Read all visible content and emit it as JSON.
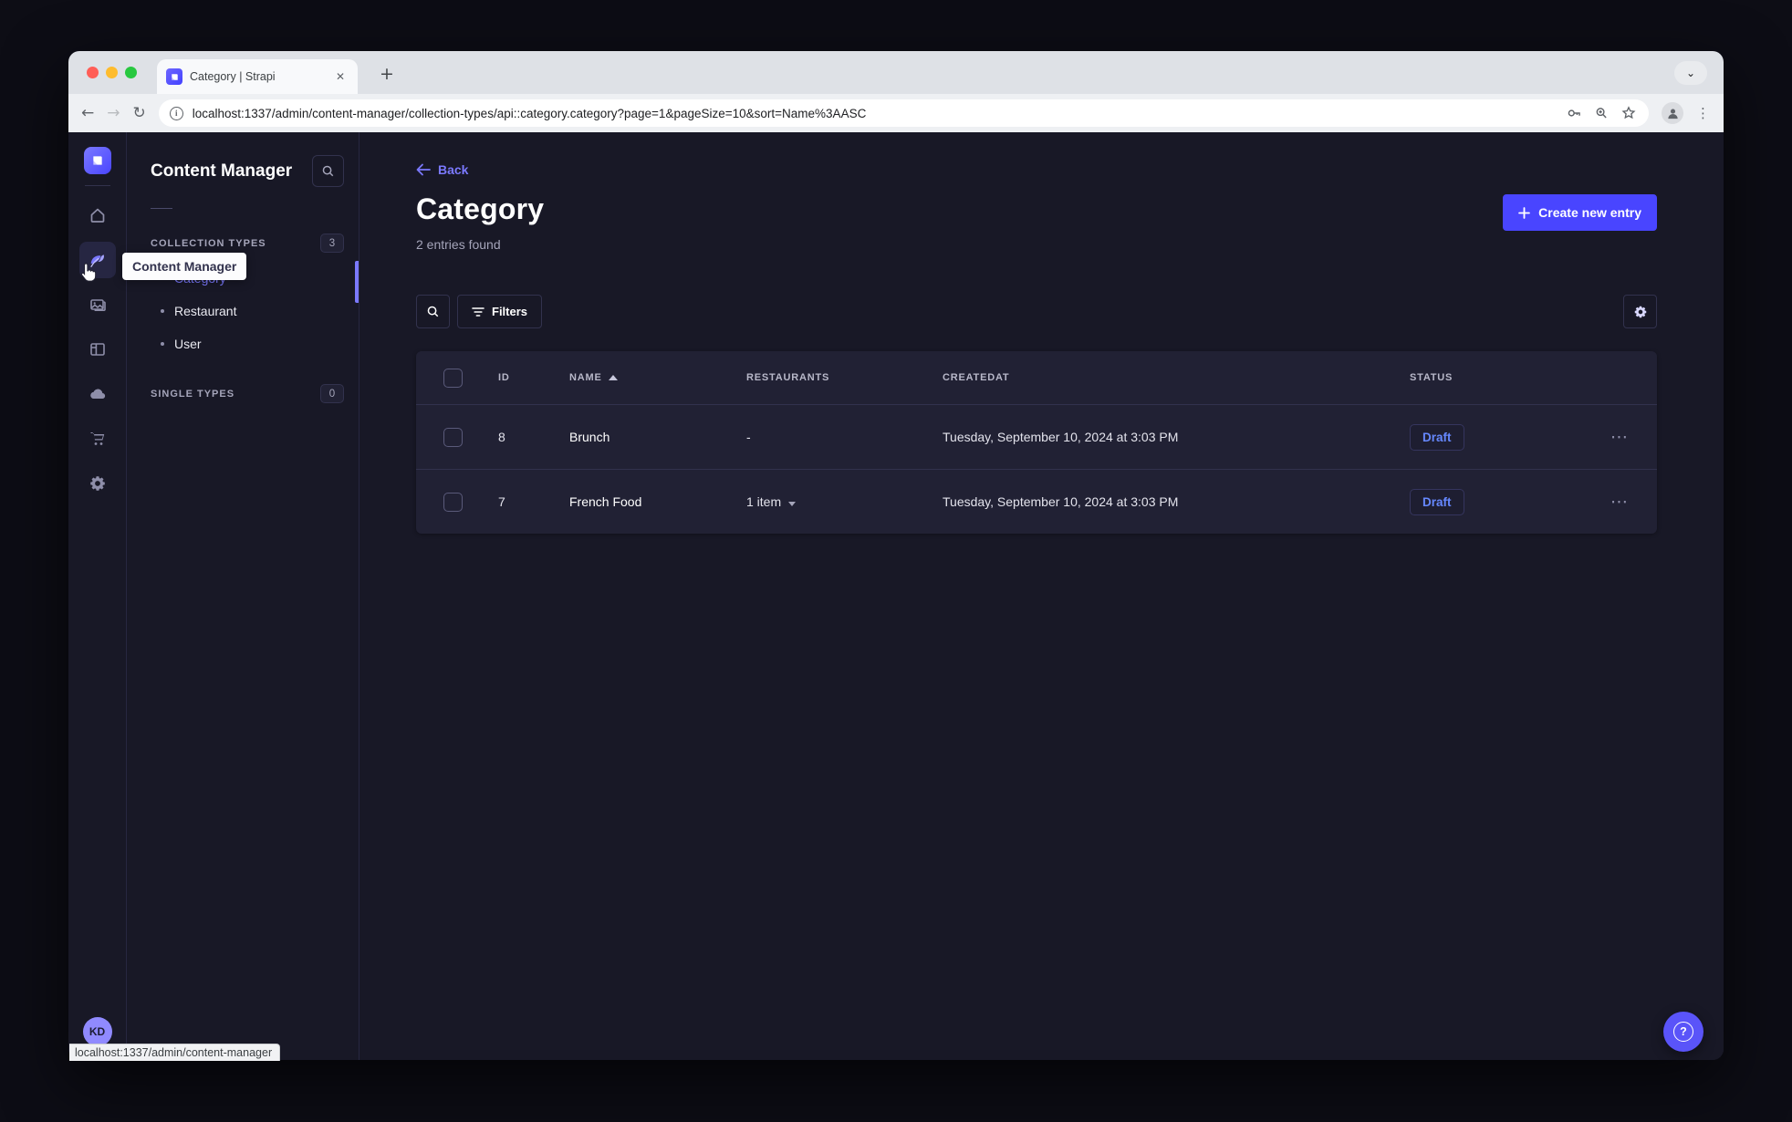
{
  "browser": {
    "tab_title": "Category | Strapi",
    "url": "localhost:1337/admin/content-manager/collection-types/api::category.category?page=1&pageSize=10&sort=Name%3AASC",
    "status_link_preview": "localhost:1337/admin/content-manager"
  },
  "rail": {
    "icons": [
      "strapi-logo",
      "home",
      "content-manager",
      "media-library",
      "content-type-builder",
      "cloud",
      "marketplace",
      "settings"
    ],
    "avatar_initials": "KD",
    "tooltip": "Content Manager"
  },
  "subnav": {
    "title": "Content Manager",
    "collection_section": {
      "label": "COLLECTION TYPES",
      "count": "3",
      "items": [
        {
          "label": "Category"
        },
        {
          "label": "Restaurant"
        },
        {
          "label": "User"
        }
      ]
    },
    "single_section": {
      "label": "SINGLE TYPES",
      "count": "0"
    }
  },
  "main": {
    "back_label": "Back",
    "title": "Category",
    "subtitle": "2 entries found",
    "create_button_label": "Create new entry",
    "filters_button_label": "Filters",
    "table": {
      "headers": {
        "id": "ID",
        "name": "NAME",
        "restaurants": "RESTAURANTS",
        "createdat": "CREATEDAT",
        "status": "STATUS"
      },
      "rows": [
        {
          "id": "8",
          "name": "Brunch",
          "restaurants": "-",
          "createdat": "Tuesday, September 10, 2024 at 3:03 PM",
          "status": "Draft"
        },
        {
          "id": "7",
          "name": "French Food",
          "restaurants": "1 item",
          "createdat": "Tuesday, September 10, 2024 at 3:03 PM",
          "status": "Draft"
        }
      ]
    }
  },
  "colors": {
    "accent": "#4945ff",
    "accent_light": "#7b79ff",
    "draft_text": "#6688ff",
    "app_background": "#181826",
    "card_background": "#212134",
    "border": "#32324d"
  }
}
